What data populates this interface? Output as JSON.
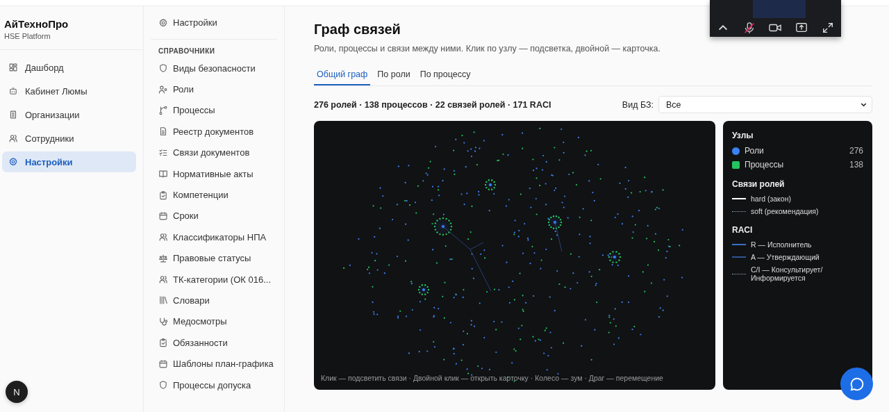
{
  "brand": {
    "title": "АйТехноПро",
    "subtitle": "HSE Platform"
  },
  "sidebar": {
    "items": [
      {
        "label": "Дашборд",
        "selected": false
      },
      {
        "label": "Кабинет Люмы",
        "selected": false
      },
      {
        "label": "Организации",
        "selected": false
      },
      {
        "label": "Сотрудники",
        "selected": false
      },
      {
        "label": "Настройки",
        "selected": true
      }
    ]
  },
  "subnav": {
    "header_item": "Настройки",
    "section": "СПРАВОЧНИКИ",
    "items": [
      "Виды безопасности",
      "Роли",
      "Процессы",
      "Реестр документов",
      "Связи документов",
      "Нормативные акты",
      "Компетенции",
      "Сроки",
      "Классификаторы НПА",
      "Правовые статусы",
      "ТК-категории (ОК 016...",
      "Словари",
      "Медосмотры",
      "Обязанности",
      "Шаблоны план-графика",
      "Процессы допуска"
    ]
  },
  "page": {
    "title": "Граф связей",
    "subtitle": "Роли, процессы и связи между ними. Клик по узлу — подсветка, двойной — карточка."
  },
  "tabs": [
    {
      "label": "Общий граф",
      "selected": true
    },
    {
      "label": "По роли",
      "selected": false
    },
    {
      "label": "По процессу",
      "selected": false
    }
  ],
  "stats": "276 ролей · 138 процессов · 22 связей ролей · 171 RACI",
  "filter": {
    "label": "Вид БЗ:",
    "value": "Все"
  },
  "graph": {
    "hint": "Клик — подсветить связи · Двойной клик — открыть карточку · Колесо — зум · Драг — перемещение"
  },
  "legend": {
    "sections": [
      {
        "title": "Узлы",
        "items": [
          {
            "kind": "circle",
            "color": "#3b82f6",
            "label": "Роли",
            "count": "276"
          },
          {
            "kind": "square",
            "color": "#22c55e",
            "label": "Процессы",
            "count": "138"
          }
        ]
      },
      {
        "title": "Связи ролей",
        "items": [
          {
            "kind": "solid",
            "color": "#ffffff",
            "label": "hard (закон)"
          },
          {
            "kind": "dashed",
            "color": "#9ca3af",
            "label": "soft (рекомендация)"
          }
        ]
      },
      {
        "title": "RACI",
        "items": [
          {
            "kind": "solid",
            "color": "#3b6fc4",
            "label": "R — Исполнитель"
          },
          {
            "kind": "solid",
            "color": "#2f5596",
            "label": "A — Утверждающий"
          },
          {
            "kind": "dashed",
            "color": "#9ca3af",
            "label": "C/I — Консультирует/ Информируется"
          }
        ]
      }
    ]
  },
  "user_badge": "N"
}
